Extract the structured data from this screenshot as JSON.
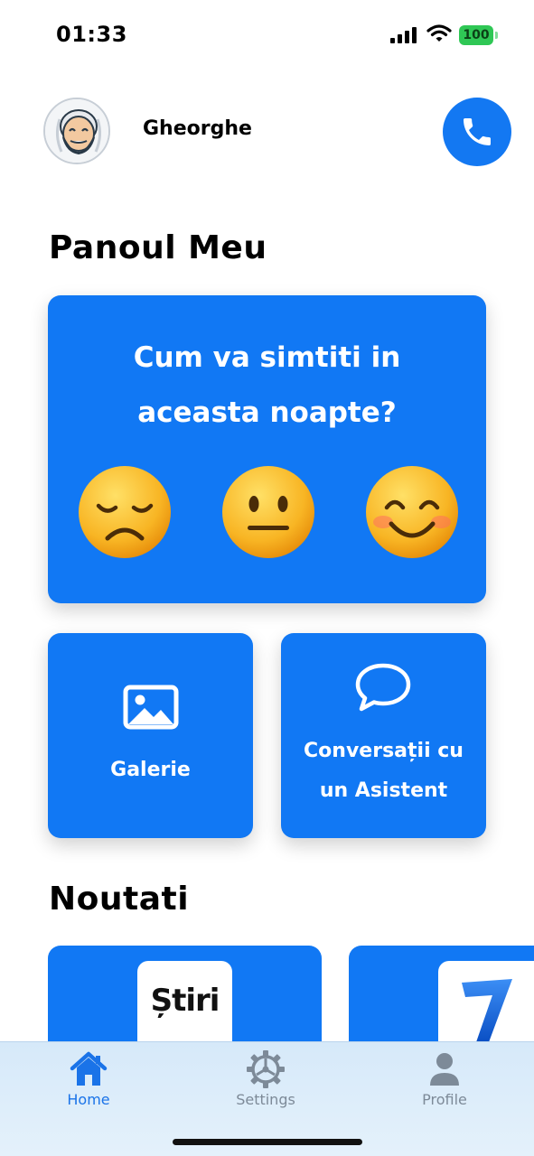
{
  "status_bar": {
    "time": "01:33",
    "battery": "100",
    "icons": [
      "cellular-signal-icon",
      "wifi-icon",
      "battery-icon"
    ]
  },
  "header": {
    "user_name": "Gheorghe",
    "avatar_icon": "grandfather-avatar-icon",
    "call_icon": "phone-icon"
  },
  "dashboard": {
    "title": "Panoul Meu",
    "mood": {
      "question_line1": "Cum va simtiti in",
      "question_line2": "aceasta noapte?",
      "options": [
        "sad-face-icon",
        "neutral-face-icon",
        "happy-face-icon"
      ]
    },
    "tiles": [
      {
        "icon": "image-gallery-icon",
        "label": "Galerie"
      },
      {
        "icon": "speech-bubble-icon",
        "label_line1": "Conversații cu",
        "label_line2": "un Asistent"
      }
    ]
  },
  "news": {
    "title": "Noutati",
    "items": [
      {
        "logo_text": "Știri"
      },
      {
        "logo_icon": "blue-seven-logo-icon"
      }
    ]
  },
  "tab_bar": {
    "tabs": [
      {
        "label": "Home",
        "icon": "home-icon",
        "active": true
      },
      {
        "label": "Settings",
        "icon": "gear-icon",
        "active": false
      },
      {
        "label": "Profile",
        "icon": "person-icon",
        "active": false
      }
    ]
  },
  "colors": {
    "primary": "#1178f4",
    "tab_active": "#1a73e8",
    "tab_inactive": "#7d8a98",
    "battery": "#2fc755"
  }
}
